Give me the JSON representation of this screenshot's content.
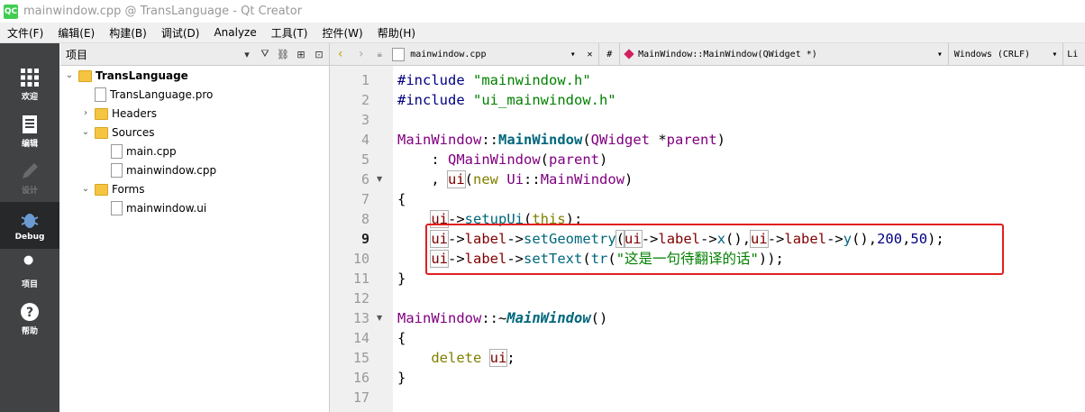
{
  "window": {
    "title": "mainwindow.cpp @ TransLanguage - Qt Creator",
    "logo": "QC"
  },
  "menu": [
    "文件(F)",
    "编辑(E)",
    "构建(B)",
    "调试(D)",
    "Analyze",
    "工具(T)",
    "控件(W)",
    "帮助(H)"
  ],
  "modes": [
    {
      "label": "欢迎",
      "icon": "grid-icon"
    },
    {
      "label": "编辑",
      "icon": "document-icon"
    },
    {
      "label": "设计",
      "icon": "pen-icon"
    },
    {
      "label": "Debug",
      "icon": "bug-icon"
    },
    {
      "label": "项目",
      "icon": "wrench-icon"
    },
    {
      "label": "帮助",
      "icon": "help-icon"
    }
  ],
  "project_panel": {
    "title": "项目",
    "tree": [
      {
        "label": "TransLanguage",
        "bold": true
      },
      {
        "label": "TransLanguage.pro"
      },
      {
        "label": "Headers"
      },
      {
        "label": "Sources"
      },
      {
        "label": "main.cpp"
      },
      {
        "label": "mainwindow.cpp"
      },
      {
        "label": "Forms"
      },
      {
        "label": "mainwindow.ui"
      }
    ]
  },
  "editor_toolbar": {
    "file": "mainwindow.cpp",
    "hash": "#",
    "symbol": "MainWindow::MainWindow(QWidget *)",
    "line_ending": "Windows (CRLF)",
    "extra": "Li"
  },
  "line_numbers": [
    "1",
    "2",
    "3",
    "4",
    "5",
    "6",
    "7",
    "8",
    "9",
    "10",
    "11",
    "12",
    "13",
    "14",
    "15",
    "16",
    "17"
  ],
  "code": {
    "l1": {
      "a": "#include ",
      "b": "\"mainwindow.h\""
    },
    "l2": {
      "a": "#include ",
      "b": "\"ui_mainwindow.h\""
    },
    "l4": {
      "a": "MainWindow",
      "b": "::",
      "c": "MainWindow",
      "d": "(",
      "e": "QWidget",
      "f": " *",
      "g": "parent",
      "h": ")"
    },
    "l5": {
      "a": "    : ",
      "b": "QMainWindow",
      "c": "(",
      "d": "parent",
      "e": ")"
    },
    "l6": {
      "a": "    , ",
      "b": "ui",
      "c": "(",
      "d": "new",
      "e": " ",
      "f": "Ui",
      "g": "::",
      "h": "MainWindow",
      "i": ")"
    },
    "l7": "{",
    "l8": {
      "a": "    ",
      "b": "ui",
      "c": "->",
      "d": "setupUi",
      "e": "(",
      "f": "this",
      "g": ");"
    },
    "l9": {
      "a": "    ",
      "b": "ui",
      "c": "->",
      "d": "label",
      "e": "->",
      "f": "setGeometry",
      "g": "(",
      "h": "ui",
      "i": "->",
      "j": "label",
      "k": "->",
      "l": "x",
      "m": "(),",
      "n": "ui",
      "o": "->",
      "p": "label",
      "q": "->",
      "r": "y",
      "s": "(),",
      "t": "200",
      "u": ",",
      "v": "50",
      "w": ");"
    },
    "l10": {
      "a": "    ",
      "b": "ui",
      "c": "->",
      "d": "label",
      "e": "->",
      "f": "setText",
      "g": "(",
      "h": "tr",
      "i": "(",
      "j": "\"这是一句待翻译的话\"",
      "k": "));"
    },
    "l11": "}",
    "l13": {
      "a": "MainWindow",
      "b": "::~",
      "c": "MainWindow",
      "d": "()"
    },
    "l14": "{",
    "l15": {
      "a": "    ",
      "b": "delete",
      "c": " ",
      "d": "ui",
      "e": ";"
    },
    "l16": "}"
  },
  "colors": {
    "highlight_box": "#e02020",
    "modebar_bg": "#404244",
    "keyword": "#808000",
    "string": "#008000",
    "class": "#800080",
    "function": "#00677c"
  }
}
